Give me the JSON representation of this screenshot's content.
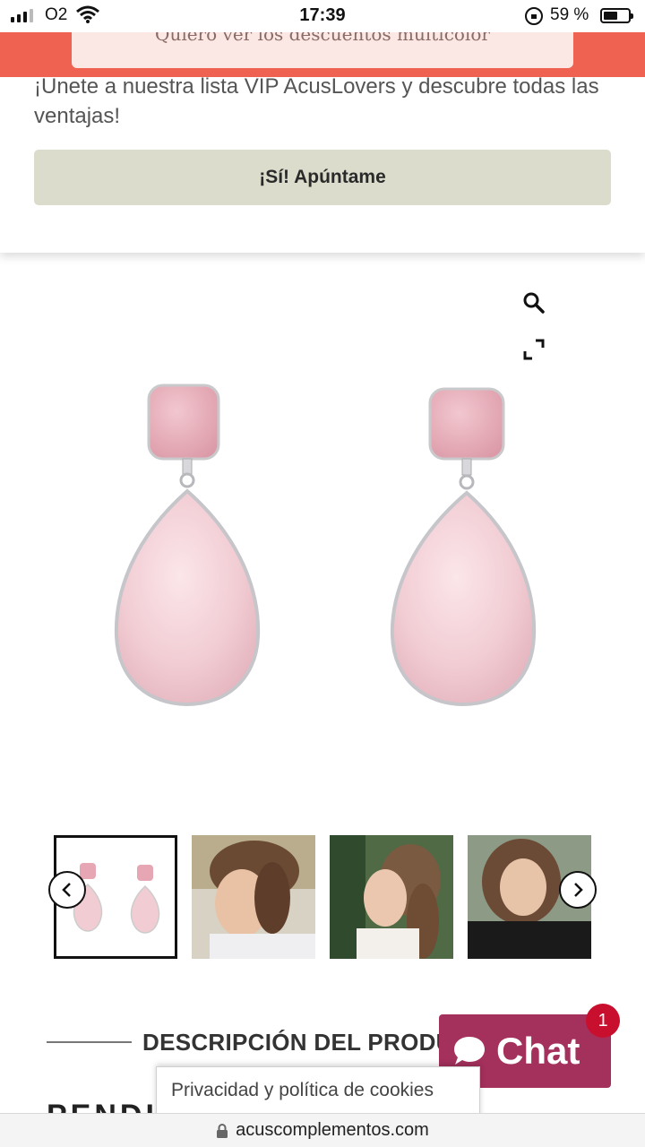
{
  "status_bar": {
    "carrier": "O2",
    "time": "17:39",
    "battery_percent": "59 %",
    "battery_level": 0.59,
    "signal_bars": 3
  },
  "promo_banner": {
    "text": "Quiero ver los descuentos multicolor",
    "color": "#ef6150"
  },
  "vip": {
    "text": "¡Únete a nuestra lista VIP AcusLovers y descubre todas las ventajas!",
    "button_label": "¡Sí! Apúntame"
  },
  "product": {
    "icons": [
      "search-icon",
      "fullscreen-icon"
    ],
    "stone_color": "#f1ccd3",
    "thumbnails": [
      {
        "name": "thumbnail-earrings",
        "active": true
      },
      {
        "name": "thumbnail-model-profile",
        "active": false
      },
      {
        "name": "thumbnail-model-hand",
        "active": false
      },
      {
        "name": "thumbnail-model-black-sweater",
        "active": false
      }
    ]
  },
  "description": {
    "heading": "DESCRIPCIÓN DEL PRODUCTO",
    "body_cut": "PENDIENTES ..."
  },
  "chat": {
    "label": "Chat",
    "badge_count": "1",
    "color": "#a4305c"
  },
  "privacy": {
    "label": "Privacidad y política de cookies"
  },
  "browser": {
    "url": "acuscomplementos.com"
  }
}
